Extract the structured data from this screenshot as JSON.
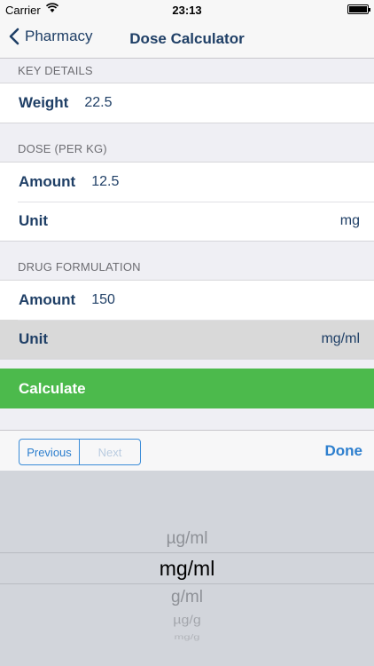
{
  "status": {
    "carrier": "Carrier",
    "time": "23:13",
    "battery_level": 1.0
  },
  "nav": {
    "back_label": "Pharmacy",
    "title": "Dose Calculator"
  },
  "sections": {
    "key_details": {
      "header": "KEY DETAILS",
      "weight_label": "Weight",
      "weight_value": "22.5"
    },
    "dose": {
      "header": "DOSE (PER KG)",
      "amount_label": "Amount",
      "amount_value": "12.5",
      "unit_label": "Unit",
      "unit_value": "mg"
    },
    "formulation": {
      "header": "DRUG FORMULATION",
      "amount_label": "Amount",
      "amount_value": "150",
      "unit_label": "Unit",
      "unit_value": "mg/ml"
    }
  },
  "calculate_label": "Calculate",
  "toolbar": {
    "previous_label": "Previous",
    "next_label": "Next",
    "done_label": "Done"
  },
  "picker": {
    "options": [
      "µg/ml",
      "mg/ml",
      "g/ml",
      "µg/g",
      "mg/g"
    ],
    "selected": "mg/ml"
  },
  "colors": {
    "accent": "#2d7fce",
    "calculate": "#4cba4c",
    "text": "#1f3f66"
  }
}
